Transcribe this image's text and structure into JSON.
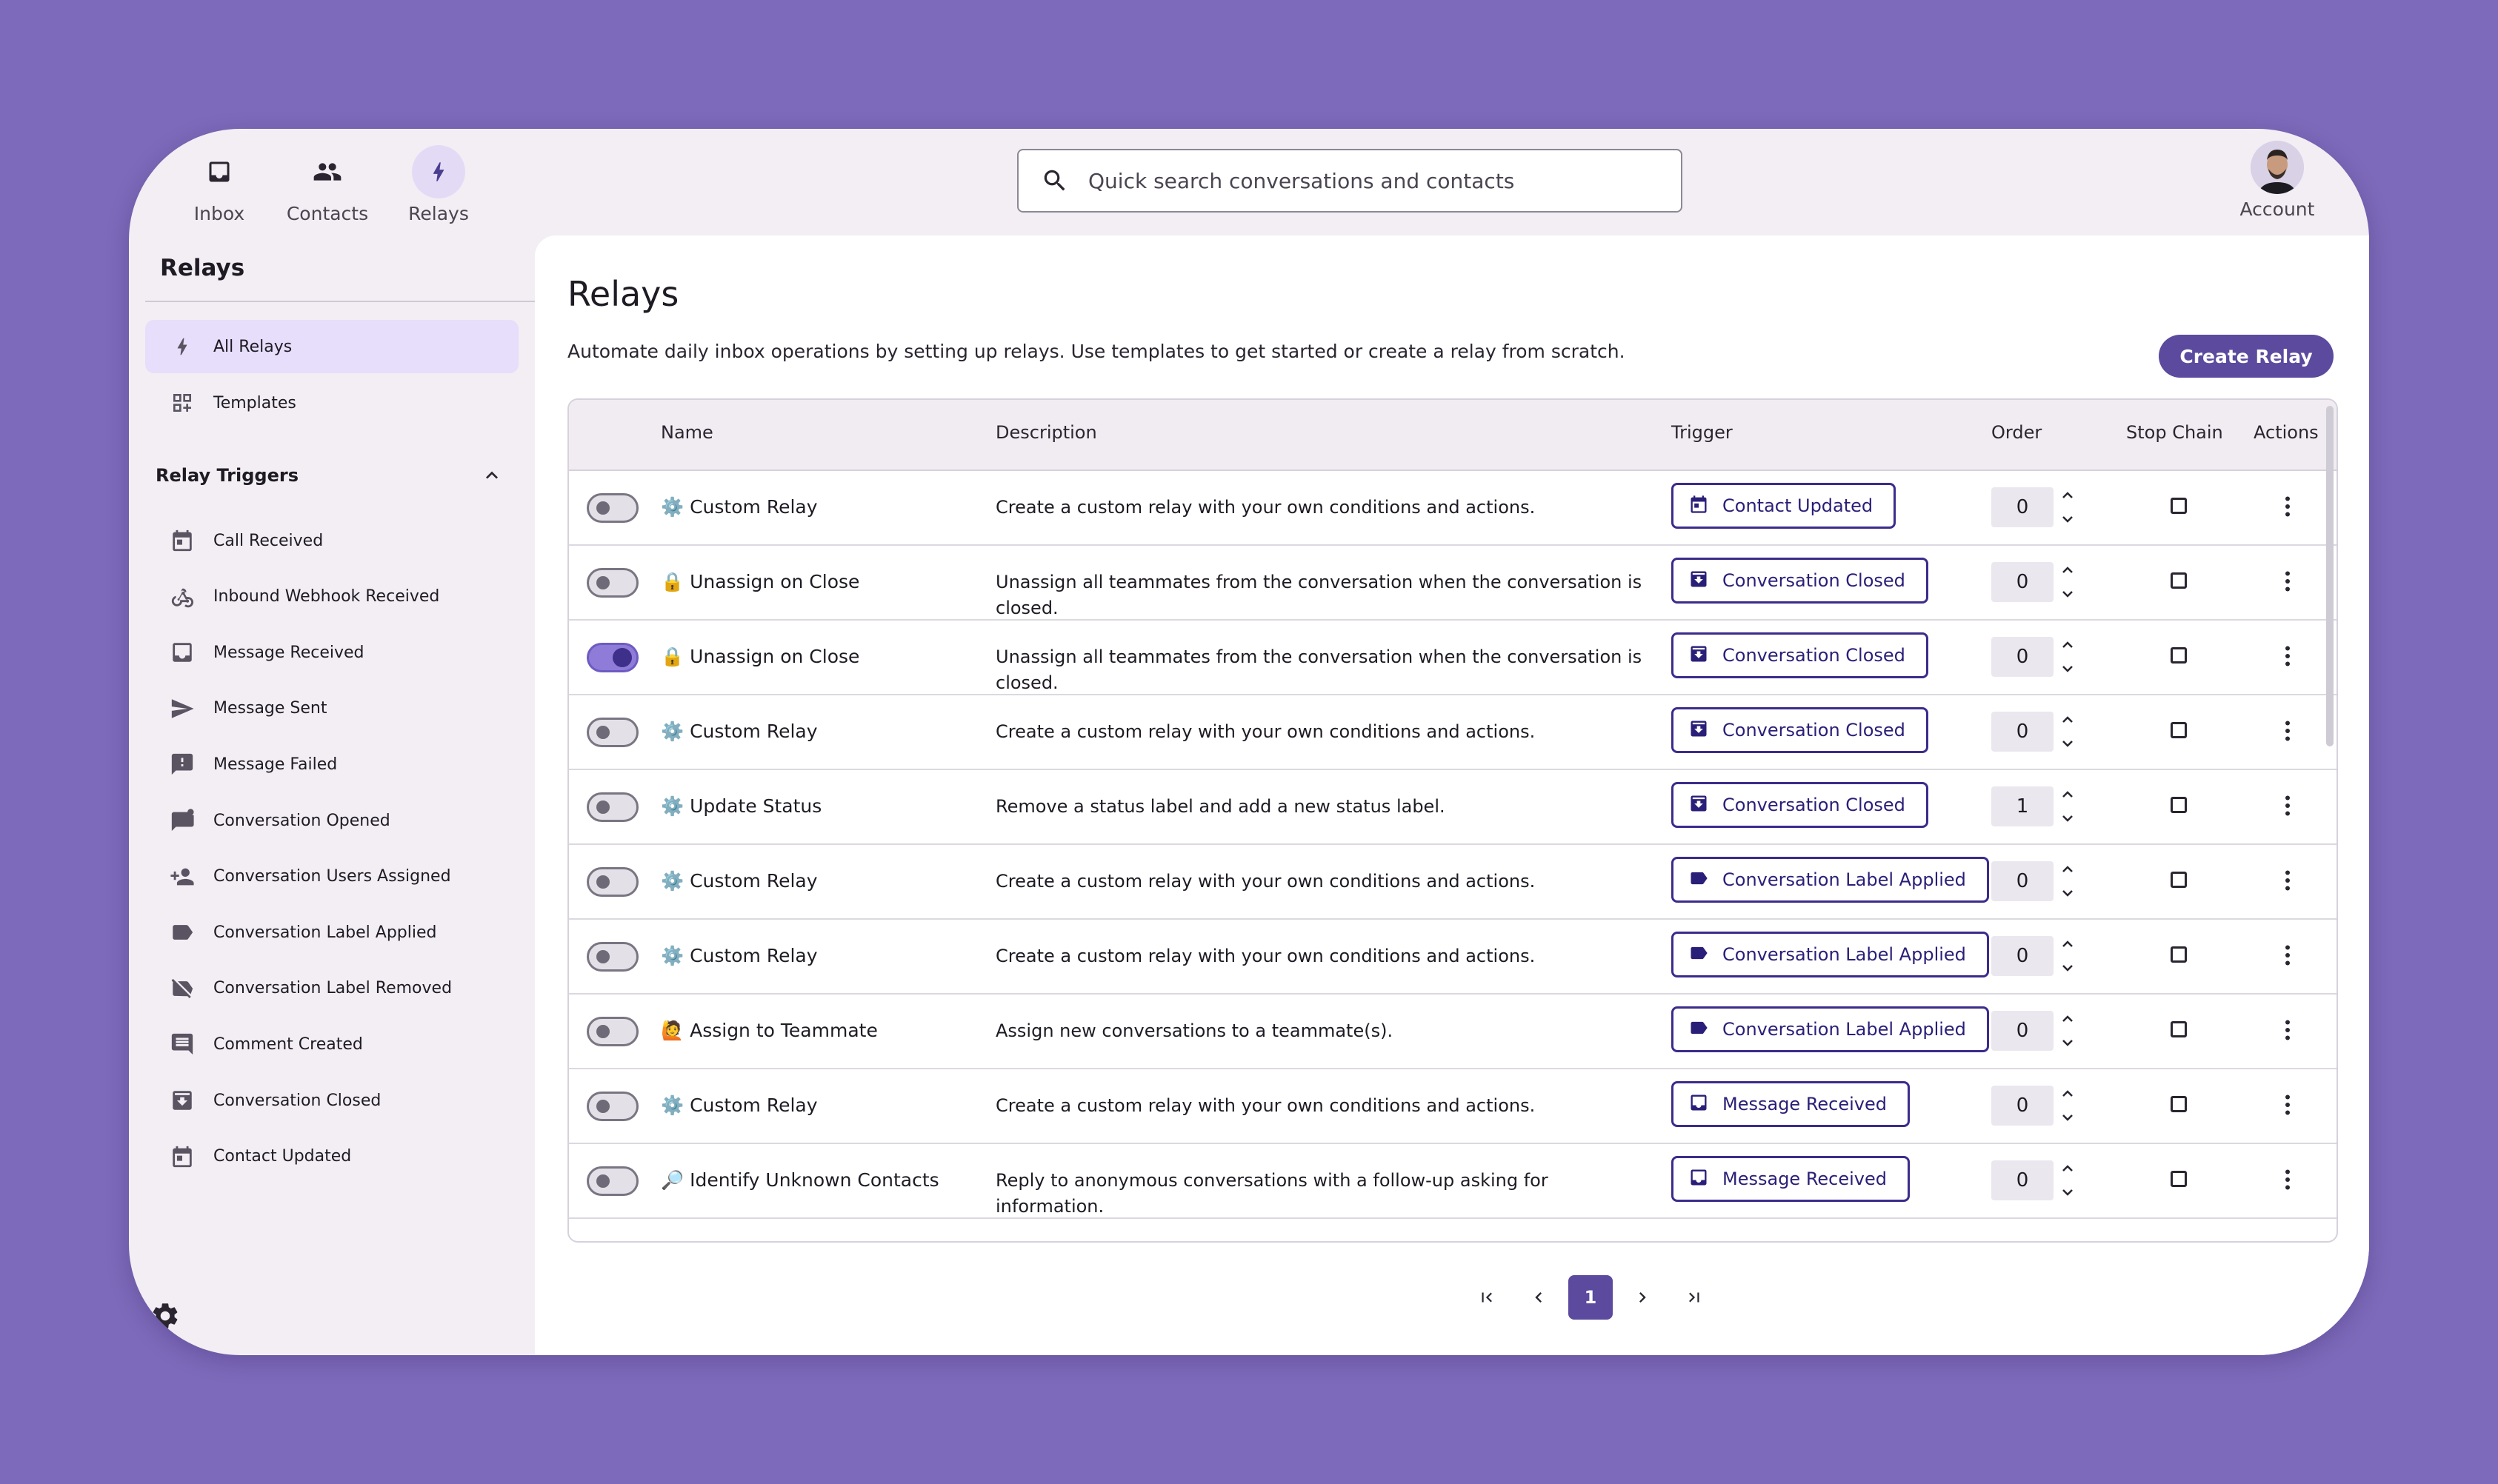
{
  "nav": {
    "inbox": "Inbox",
    "contacts": "Contacts",
    "relays": "Relays",
    "account": "Account"
  },
  "search": {
    "placeholder": "Quick search conversations and contacts"
  },
  "sidebar": {
    "title": "Relays",
    "items": [
      {
        "label": "All Relays",
        "icon": "bolt-icon"
      },
      {
        "label": "Templates",
        "icon": "templates-icon"
      }
    ],
    "section_title": "Relay Triggers",
    "triggers": [
      {
        "label": "Call Received",
        "icon": "calendar-icon"
      },
      {
        "label": "Inbound Webhook Received",
        "icon": "webhook-icon"
      },
      {
        "label": "Message Received",
        "icon": "inbox-icon"
      },
      {
        "label": "Message Sent",
        "icon": "send-icon"
      },
      {
        "label": "Message Failed",
        "icon": "message-failed-icon"
      },
      {
        "label": "Conversation Opened",
        "icon": "chat-icon"
      },
      {
        "label": "Conversation Users Assigned",
        "icon": "person-add-icon"
      },
      {
        "label": "Conversation Label Applied",
        "icon": "label-icon"
      },
      {
        "label": "Conversation Label Removed",
        "icon": "label-off-icon"
      },
      {
        "label": "Comment Created",
        "icon": "comment-icon"
      },
      {
        "label": "Conversation Closed",
        "icon": "archive-icon"
      },
      {
        "label": "Contact Updated",
        "icon": "calendar-icon"
      }
    ]
  },
  "page": {
    "title": "Relays",
    "description": "Automate daily inbox operations by setting up relays. Use templates to get started or create a relay from scratch.",
    "create_button": "Create Relay"
  },
  "table": {
    "columns": [
      "Name",
      "Description",
      "Trigger",
      "Order",
      "Stop Chain",
      "Actions"
    ],
    "rows": [
      {
        "enabled": false,
        "emoji": "⚙️",
        "name": "Custom Relay",
        "description": "Create a custom relay with your own conditions and actions.",
        "trigger": "Contact Updated",
        "trigger_icon": "calendar-icon",
        "order": "0"
      },
      {
        "enabled": false,
        "emoji": "🔒",
        "name": "Unassign on Close",
        "description": "Unassign all teammates from the conversation when the conversation is closed.",
        "trigger": "Conversation Closed",
        "trigger_icon": "archive-icon",
        "order": "0"
      },
      {
        "enabled": true,
        "emoji": "🔒",
        "name": "Unassign on Close",
        "description": "Unassign all teammates from the conversation when the conversation is closed.",
        "trigger": "Conversation Closed",
        "trigger_icon": "archive-icon",
        "order": "0"
      },
      {
        "enabled": false,
        "emoji": "⚙️",
        "name": "Custom Relay",
        "description": "Create a custom relay with your own conditions and actions.",
        "trigger": "Conversation Closed",
        "trigger_icon": "archive-icon",
        "order": "0"
      },
      {
        "enabled": false,
        "emoji": "⚙️",
        "name": "Update Status",
        "description": "Remove a status label and add a new status label.",
        "trigger": "Conversation Closed",
        "trigger_icon": "archive-icon",
        "order": "1"
      },
      {
        "enabled": false,
        "emoji": "⚙️",
        "name": "Custom Relay",
        "description": "Create a custom relay with your own conditions and actions.",
        "trigger": "Conversation Label Applied",
        "trigger_icon": "label-icon",
        "order": "0"
      },
      {
        "enabled": false,
        "emoji": "⚙️",
        "name": "Custom Relay",
        "description": "Create a custom relay with your own conditions and actions.",
        "trigger": "Conversation Label Applied",
        "trigger_icon": "label-icon",
        "order": "0"
      },
      {
        "enabled": false,
        "emoji": "🙋",
        "name": "Assign to Teammate",
        "description": "Assign new conversations to a teammate(s).",
        "trigger": "Conversation Label Applied",
        "trigger_icon": "label-icon",
        "order": "0"
      },
      {
        "enabled": false,
        "emoji": "⚙️",
        "name": "Custom Relay",
        "description": "Create a custom relay with your own conditions and actions.",
        "trigger": "Message Received",
        "trigger_icon": "inbox-icon",
        "order": "0"
      },
      {
        "enabled": false,
        "emoji": "🔎",
        "name": "Identify Unknown Contacts",
        "description": "Reply to anonymous conversations with a follow-up asking for information.",
        "trigger": "Message Received",
        "trigger_icon": "inbox-icon",
        "order": "0"
      }
    ]
  },
  "pagination": {
    "current_page": "1"
  },
  "colors": {
    "background": "#7d6aba",
    "accent": "#5b4a9e",
    "trigger_border": "#3b2c8c",
    "active_nav": "#e6defa"
  }
}
